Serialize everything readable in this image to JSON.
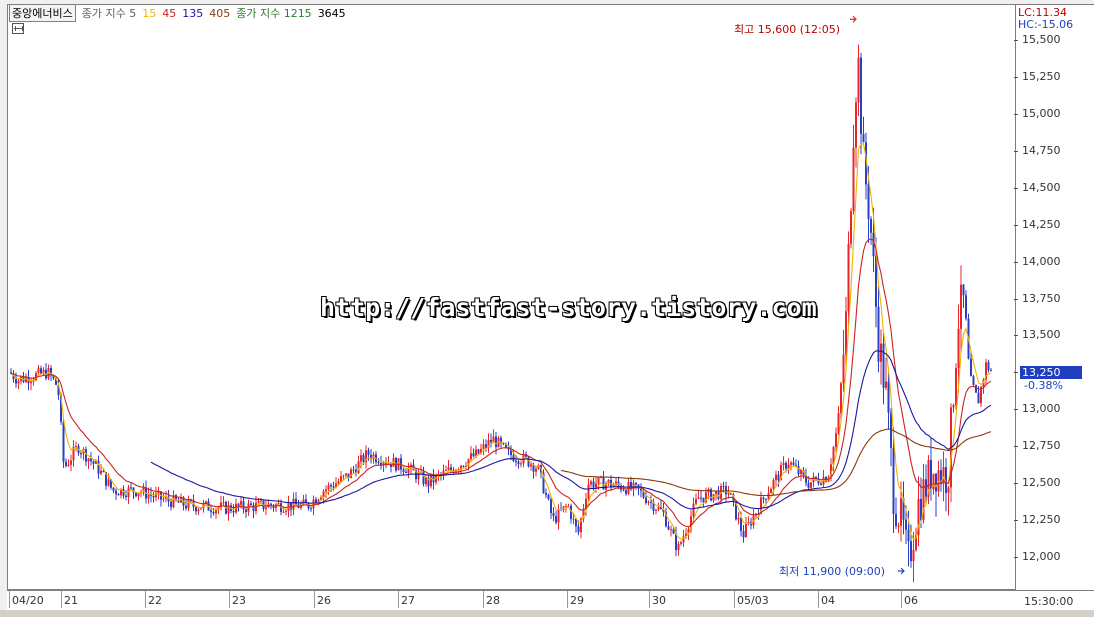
{
  "legend": {
    "symbol": "중앙에너비스",
    "ma_label": "종가 지수 5",
    "ma_15": "15",
    "ma_45": "45",
    "ma_135": "135",
    "ma_405": "405",
    "ma2_label": "종가 지수 1215",
    "ma2_value": "3645"
  },
  "watermark": "http://fastfast-story.tistory.com",
  "price_box": {
    "lc": "LC:11.34",
    "hc": "HC:-15.06",
    "current": "13,250",
    "change": "-0.38%"
  },
  "annotations": {
    "high": "최고 15,600 (12:05)",
    "low": "최저 11,900 (09:00)"
  },
  "time_label": "15:30:00",
  "colors": {
    "up": "#e8262a",
    "down": "#2b3fc4",
    "ma5": "#f0b400",
    "ma15": "#cc2222",
    "ma45": "#1a1aa0",
    "ma135": "#8b3a0a"
  },
  "chart_data": {
    "type": "candlestick",
    "title": "",
    "y_axis": {
      "ticks": [
        "15,500",
        "15,250",
        "15,000",
        "14,750",
        "14,500",
        "14,250",
        "14,000",
        "13,750",
        "13,500",
        "13,250",
        "13,000",
        "12,750",
        "12,500",
        "12,250",
        "12,000"
      ],
      "ylim": [
        11800,
        15700
      ]
    },
    "x_axis": {
      "ticks": [
        "04/20",
        "21",
        "22",
        "23",
        "26",
        "27",
        "28",
        "29",
        "30",
        "05/03",
        "04",
        "06"
      ]
    },
    "series": [
      {
        "name": "5",
        "type": "line"
      },
      {
        "name": "15",
        "type": "line"
      },
      {
        "name": "45",
        "type": "line"
      },
      {
        "name": "135",
        "type": "line"
      }
    ],
    "keypoints": [
      {
        "x": "04/20",
        "y": 13200
      },
      {
        "x": "21",
        "y": 12700
      },
      {
        "x": "22",
        "y": 12450
      },
      {
        "x": "23",
        "y": 12350
      },
      {
        "x": "26",
        "y": 12400
      },
      {
        "x": "27",
        "y": 12600
      },
      {
        "x": "28",
        "y": 12750
      },
      {
        "x": "29",
        "y": 12350
      },
      {
        "x": "30",
        "y": 12150
      },
      {
        "x": "05/03",
        "y": 12450
      },
      {
        "x": "04",
        "y": 15600
      },
      {
        "x": "06",
        "y": 11900
      },
      {
        "x": "06 end",
        "y": 13250
      }
    ],
    "high": 15600,
    "low": 11900,
    "grid": false
  }
}
